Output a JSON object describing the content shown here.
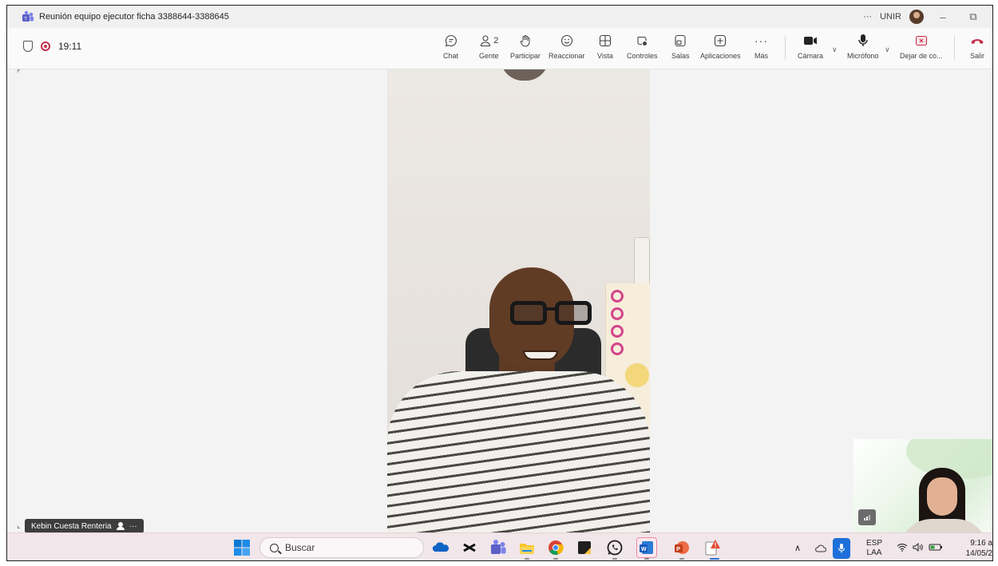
{
  "window": {
    "title": "Reunión equipo ejecutor ficha 3388644-3388645",
    "org": "UNIR",
    "more_glyph": "···",
    "min_glyph": "–",
    "restore_glyph": "⧉"
  },
  "toolbar": {
    "timer": "19:11",
    "people_count": "2",
    "items": {
      "chat": "Chat",
      "people": "Gente",
      "raise": "Participar",
      "react": "Reaccionar",
      "view": "Vista",
      "controls": "Controles",
      "rooms": "Salas",
      "apps": "Aplicaciones",
      "more": "Más",
      "camera": "Cámara",
      "mic": "Micrófono",
      "share": "Dejar de co...",
      "leave": "Salir"
    }
  },
  "stage": {
    "participant_name": "Kebin Cuesta Renteria",
    "participant_more": "···"
  },
  "taskbar": {
    "search_placeholder": "Buscar",
    "lang_top": "ESP",
    "lang_bottom": "LAA",
    "time": "9:16 a",
    "date": "14/05/2"
  },
  "colors": {
    "leave_red": "#c4314b",
    "teams_purple": "#5b5fc7",
    "taskbar_bg": "#f1e6e9"
  },
  "icons": [
    "teams-icon",
    "shield-icon",
    "record-icon",
    "chat-icon",
    "people-icon",
    "hand-icon",
    "smile-icon",
    "view-icon",
    "controls-icon",
    "rooms-icon",
    "apps-icon",
    "more-icon",
    "camera-icon",
    "mic-icon",
    "stop-share-icon",
    "leave-phone-icon"
  ]
}
